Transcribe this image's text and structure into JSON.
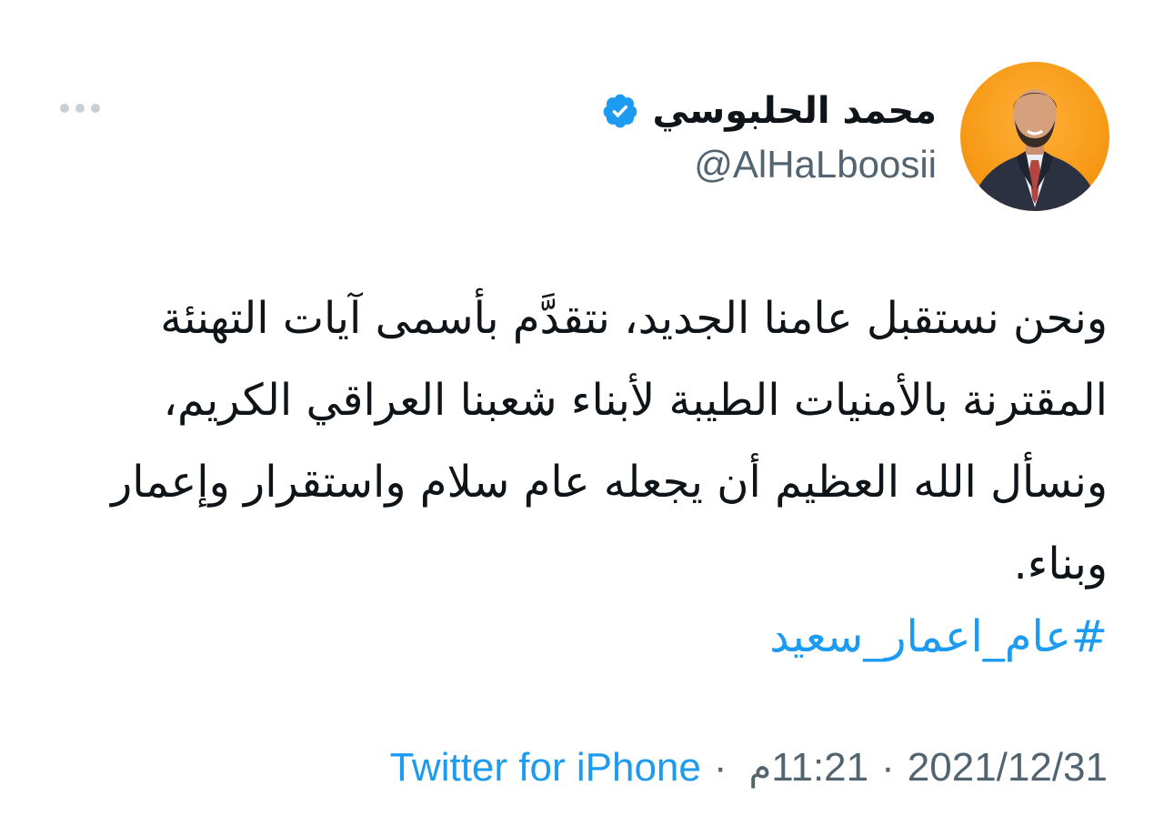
{
  "author": {
    "display_name": "محمد الحلبوسي",
    "handle": "@AlHaLboosii",
    "verified": true,
    "avatar_bg_color": "#f79a17"
  },
  "menu": {
    "icon": "more-horizontal-icon"
  },
  "tweet": {
    "text": "ونحن نستقبل عامنا الجديد، نتقدَّم بأسمى آيات التهنئة المقترنة بالأمنيات الطيبة لأبناء شعبنا العراقي الكريم، ونسأل الله العظيم أن يجعله عام سلام واستقرار وإعمار وبناء.",
    "hashtag": "#عام_اعمار_سعيد",
    "hashtag_color": "#1d9bf0"
  },
  "meta": {
    "date": "2021/12/31",
    "time": "11:21",
    "time_suffix": "م",
    "separator": "·",
    "source": "Twitter for iPhone",
    "source_color": "#1d9bf0"
  }
}
